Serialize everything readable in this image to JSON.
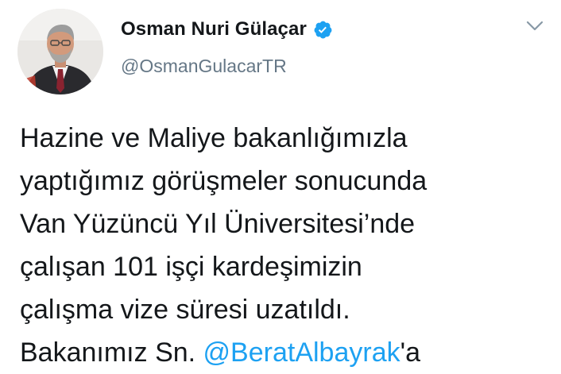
{
  "author": {
    "display_name": "Osman Nuri Gülaçar",
    "handle": "@OsmanGulacarTR",
    "verified": true,
    "avatar_icon": "profile-photo"
  },
  "tweet": {
    "lines": [
      "Hazine ve Maliye bakanlığımızla",
      "yaptığımız görüşmeler sonucunda",
      "Van Yüzüncü Yıl Üniversitesi’nde",
      "çalışan 101 işçi kardeşimizin",
      "çalışma vize süresi uzatıldı."
    ],
    "partial_line": {
      "text_before": "Bakanımız Sn. ",
      "mention": "@BeratAlbayrak",
      "text_after": "'a"
    }
  },
  "menu": {
    "icon": "chevron-down-icon"
  },
  "colors": {
    "verified_badge": "#1da1f2",
    "mention": "#1da1f2",
    "handle": "#657786",
    "text": "#14171a"
  }
}
